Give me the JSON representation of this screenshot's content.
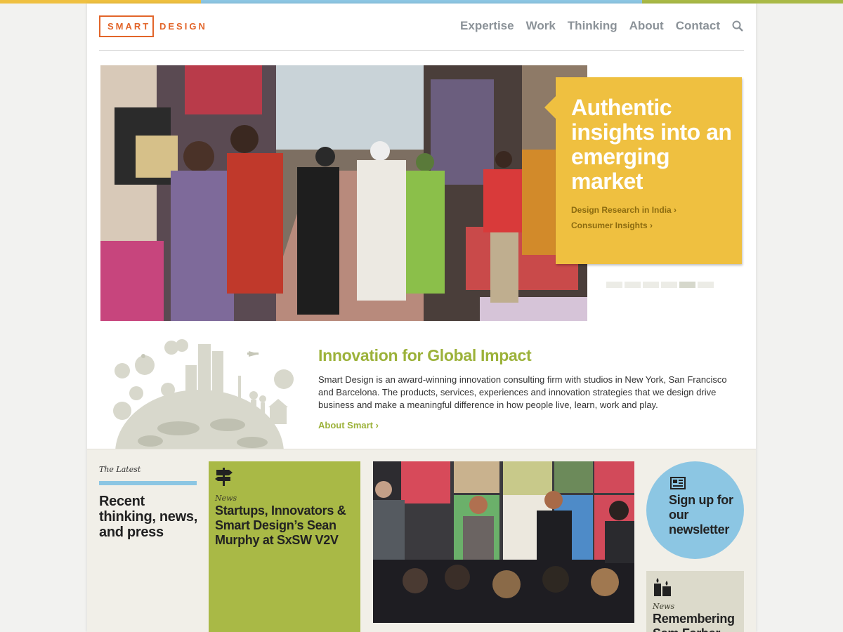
{
  "brand": {
    "logo_box": "SMART",
    "logo_word": "DESIGN",
    "color": "#e2652a"
  },
  "nav": {
    "items": [
      "Expertise",
      "Work",
      "Thinking",
      "About",
      "Contact"
    ],
    "search_icon": "search-icon"
  },
  "hero": {
    "headline": "Authentic insights into an emerging market",
    "links": [
      "Design Research in India ›",
      "Consumer Insights ›"
    ],
    "slide_count": 6,
    "active_slide": 5,
    "accent": "#efc040"
  },
  "intro": {
    "title": "Innovation for Global Impact",
    "body": "Smart Design is an award-winning innovation consulting firm with studios in New York, San Francisco and Barcelona. The products, services, experiences and innovation strategies that we design drive business and make a meaningful difference in how people live, learn, work and play.",
    "link": "About Smart ›",
    "accent": "#9cb23a"
  },
  "latest": {
    "kicker": "The Latest",
    "heading": "Recent thinking, news, and press"
  },
  "cards": {
    "green": {
      "icon": "signpost-icon",
      "kicker": "News",
      "title": "Startups, Innovators & Smart Design’s Sean Murphy at SxSW V2V"
    },
    "newsletter": {
      "icon": "newspaper-icon",
      "title": "Sign up for our newsletter"
    },
    "gray": {
      "icon": "candles-icon",
      "kicker": "News",
      "title": "Remembering Sam Farber"
    }
  }
}
